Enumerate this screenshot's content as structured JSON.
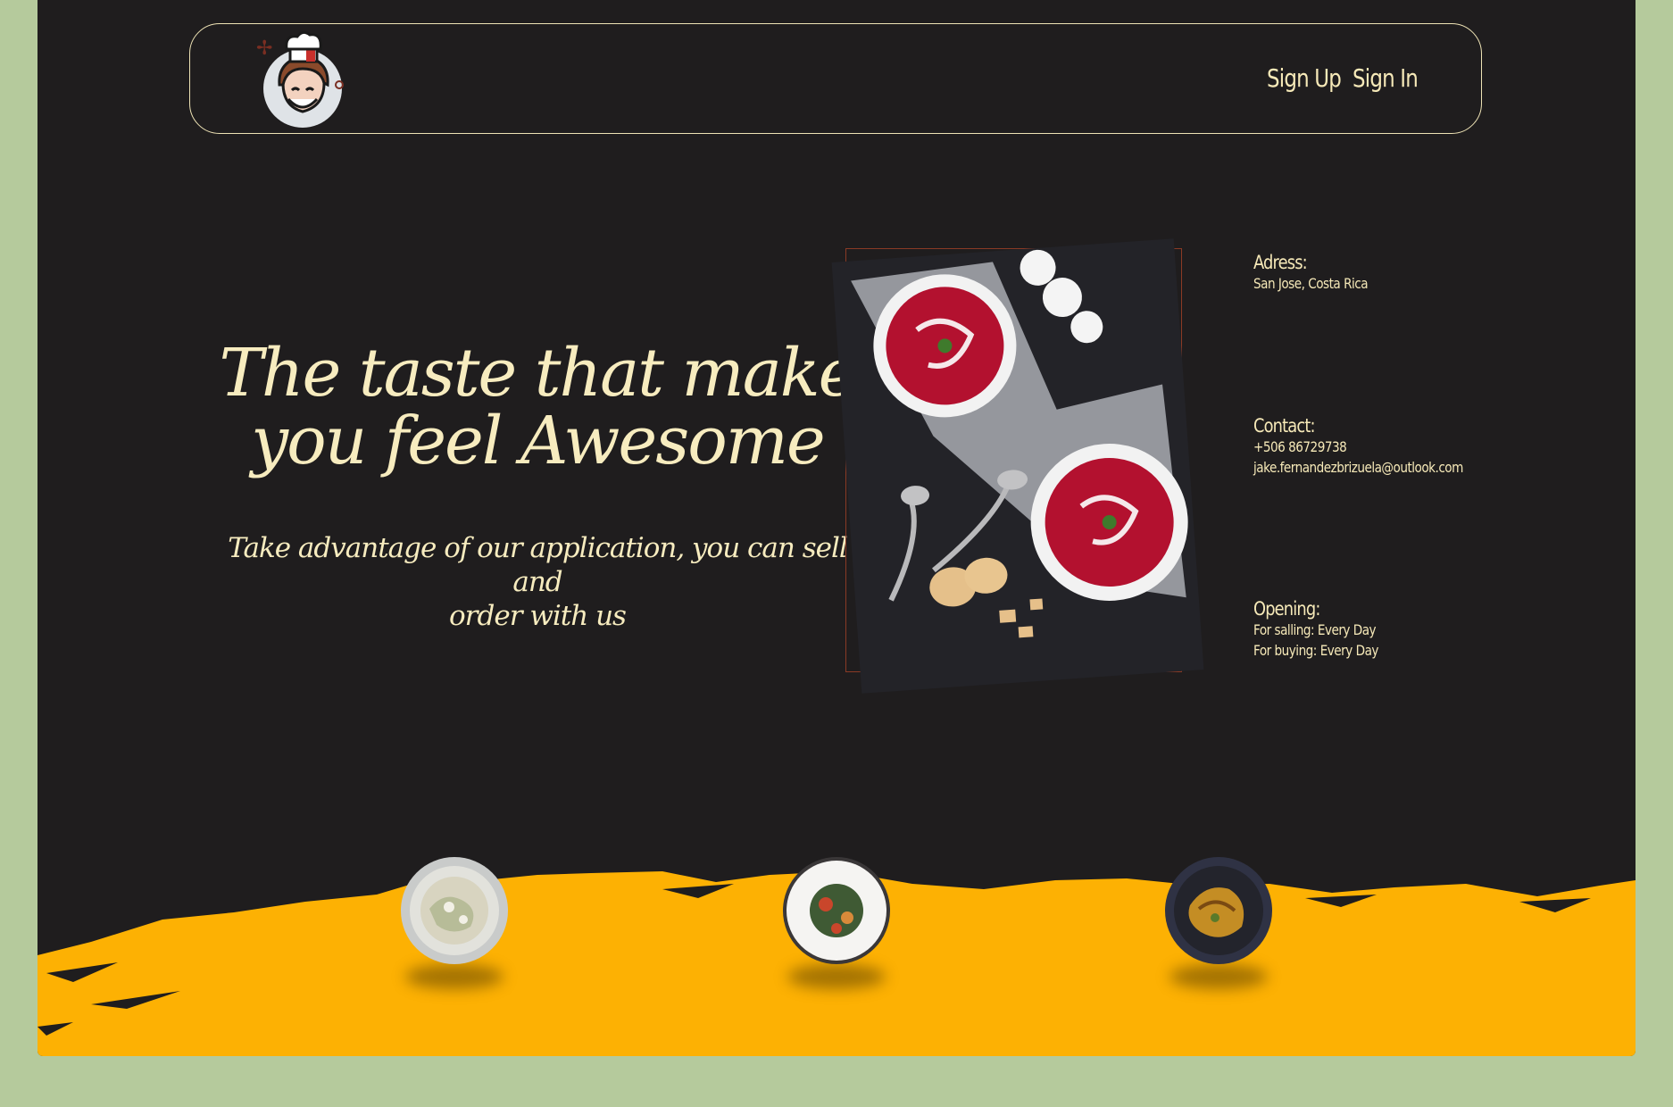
{
  "nav": {
    "signup_label": "Sign Up",
    "signin_label": "Sign In"
  },
  "hero": {
    "title_line1": "The taste that make",
    "title_line2": "you feel Awesome",
    "subtitle_line1": "Take advantage of our application, you can sell and",
    "subtitle_line2": "order with us"
  },
  "info": {
    "adress_heading": "Adress:",
    "adress_value": "San Jose, Costa Rica",
    "contact_heading": "Contact:",
    "contact_phone": "+506 86729738",
    "contact_email": "jake.fernandezbrizuela@outlook.com",
    "opening_heading": "Opening:",
    "opening_selling": "For salling: Every Day",
    "opening_buying": "For buying: Every Day"
  },
  "colors": {
    "page_bg": "#b5ca9c",
    "card_bg": "#1f1d1e",
    "text_cream": "#f6e9b8",
    "accent_yellow": "#fdb103",
    "frame_accent": "#8a3a25"
  },
  "icons": {
    "logo": "chef-avatar-icon"
  }
}
